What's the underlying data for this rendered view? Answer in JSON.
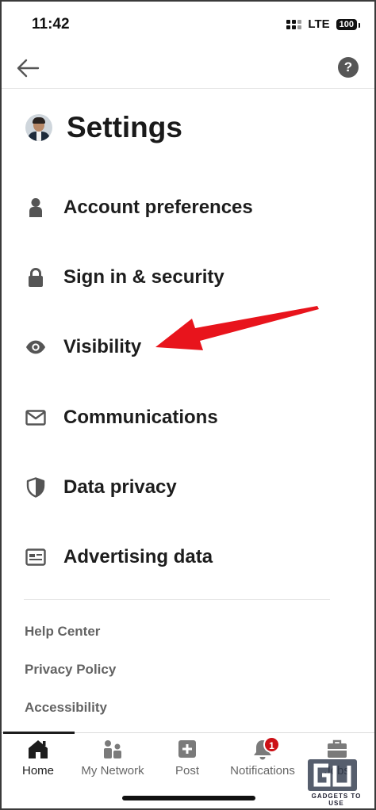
{
  "status_bar": {
    "time": "11:42",
    "network": "LTE",
    "battery": "100"
  },
  "top_nav": {
    "back_icon": "arrow-left-icon",
    "help_icon": "question-circle-icon",
    "help_glyph": "?"
  },
  "header": {
    "title": "Settings",
    "avatar_icon": "profile-photo"
  },
  "menu": {
    "items": [
      {
        "label": "Account preferences",
        "icon": "person-icon"
      },
      {
        "label": "Sign in & security",
        "icon": "lock-icon"
      },
      {
        "label": "Visibility",
        "icon": "eye-icon"
      },
      {
        "label": "Communications",
        "icon": "envelope-icon"
      },
      {
        "label": "Data privacy",
        "icon": "shield-icon"
      },
      {
        "label": "Advertising data",
        "icon": "ad-card-icon"
      }
    ]
  },
  "footer_links": [
    "Help Center",
    "Privacy Policy",
    "Accessibility"
  ],
  "tab_bar": {
    "tabs": [
      {
        "label": "Home",
        "icon": "home-icon",
        "active": true
      },
      {
        "label": "My Network",
        "icon": "network-icon",
        "active": false
      },
      {
        "label": "Post",
        "icon": "plus-square-icon",
        "active": false
      },
      {
        "label": "Notifications",
        "icon": "bell-icon",
        "active": false,
        "badge": "1"
      },
      {
        "label": "Jobs",
        "icon": "briefcase-icon",
        "active": false
      }
    ]
  },
  "annotation": {
    "arrow_color": "#e8141c"
  },
  "watermark": {
    "text": "GADGETS TO USE"
  },
  "colors": {
    "text": "#1d1d1d",
    "muted": "#636363",
    "badge": "#cc1016"
  }
}
